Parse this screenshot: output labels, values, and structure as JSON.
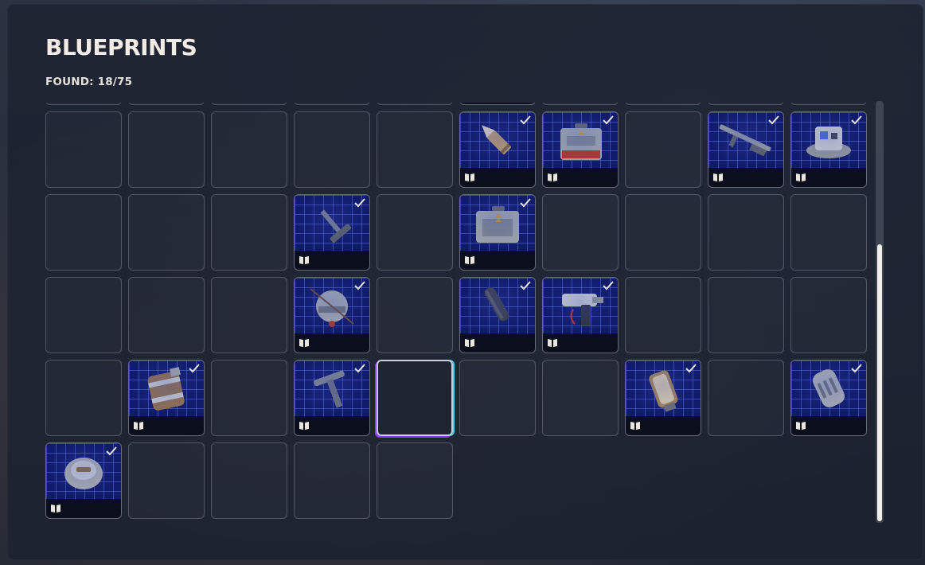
{
  "header": {
    "title": "BLUEPRINTS",
    "found_label": "FOUND: 18/75"
  },
  "colors": {
    "panel": "#1c2230",
    "item_bg": "#101b6a",
    "grid_line": "#5a6ee6",
    "title_text": "#f3ece6",
    "scroll_thumb": "#f4efe8",
    "selection_glow_left": "#8a3cff",
    "selection_glow_right": "#3ad0ff"
  },
  "grid": {
    "columns": 10,
    "rows": [
      [
        "empty",
        "empty",
        "empty",
        "empty",
        "empty",
        "found",
        "empty",
        "empty",
        "empty",
        "empty"
      ],
      [
        "empty",
        "empty",
        "empty",
        "empty",
        "empty",
        "found",
        "found",
        "empty",
        "found",
        "found"
      ],
      [
        "empty",
        "empty",
        "empty",
        "found",
        "empty",
        "found",
        "empty",
        "empty",
        "empty",
        "empty"
      ],
      [
        "empty",
        "empty",
        "empty",
        "found",
        "empty",
        "found",
        "found",
        "empty",
        "empty",
        "empty"
      ],
      [
        "empty",
        "found",
        "empty",
        "found",
        "selected",
        "empty",
        "empty",
        "found",
        "empty",
        "found"
      ],
      [
        "found",
        "empty",
        "empty",
        "empty",
        "empty"
      ]
    ],
    "items": {
      "1-5": "bullet-icon",
      "1-6": "toolcase-red-icon",
      "1-8": "rifle-icon",
      "1-9": "gadget-icon",
      "2-3": "hammer-icon",
      "2-5": "toolcase-grey-icon",
      "3-3": "helmet-icon",
      "3-5": "suppressor-icon",
      "3-6": "drill-gun-icon",
      "4-1": "canister-icon",
      "4-3": "handle-icon",
      "4-7": "fuel-cell-icon",
      "4-9": "capsule-icon",
      "5-0": "landmine-icon"
    },
    "selected_cell": "4-4"
  },
  "scrollbar": {
    "position_fraction": 0.34,
    "visible_fraction": 0.66
  }
}
